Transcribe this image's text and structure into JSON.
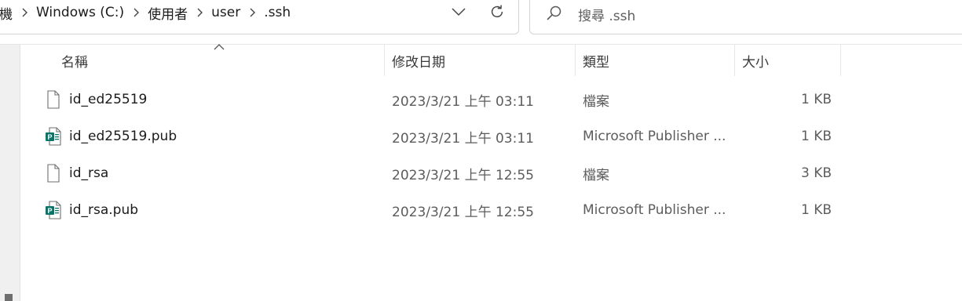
{
  "breadcrumb": {
    "items": [
      "機",
      "Windows (C:)",
      "使用者",
      "user",
      ".ssh"
    ]
  },
  "search": {
    "placeholder": "搜尋 .ssh"
  },
  "columns": {
    "name": "名稱",
    "date": "修改日期",
    "type": "類型",
    "size": "大小"
  },
  "files": [
    {
      "name": "id_ed25519",
      "date": "2023/3/21 上午 03:11",
      "type": "檔案",
      "size": "1 KB",
      "icon": "file-icon"
    },
    {
      "name": "id_ed25519.pub",
      "date": "2023/3/21 上午 03:11",
      "type": "Microsoft Publisher ...",
      "size": "1 KB",
      "icon": "publisher-file-icon"
    },
    {
      "name": "id_rsa",
      "date": "2023/3/21 上午 12:55",
      "type": "檔案",
      "size": "3 KB",
      "icon": "file-icon"
    },
    {
      "name": "id_rsa.pub",
      "date": "2023/3/21 上午 12:55",
      "type": "Microsoft Publisher ...",
      "size": "1 KB",
      "icon": "publisher-file-icon"
    }
  ],
  "colors": {
    "publisher_green": "#077568",
    "text": "#1b1b1b",
    "muted": "#5c5c5c"
  }
}
